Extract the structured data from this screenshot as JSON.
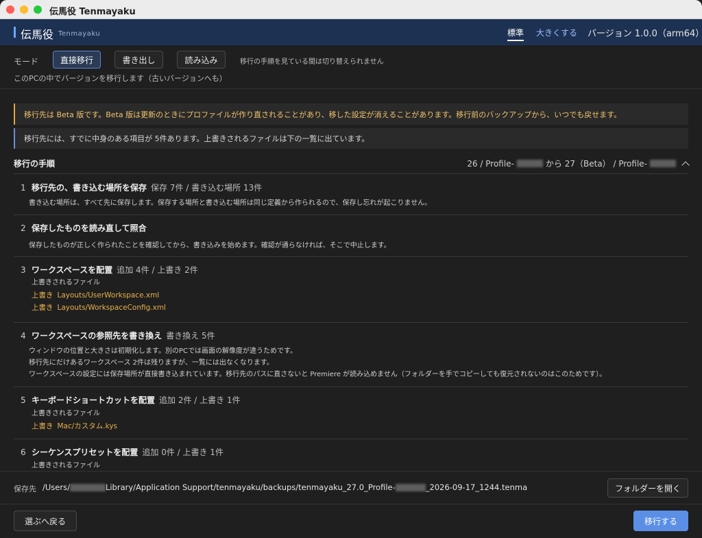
{
  "window": {
    "title": "伝馬役 Tenmayaku"
  },
  "header": {
    "brand": "伝馬役",
    "brand_sub": "Tenmayaku",
    "size_standard": "標準",
    "size_large": "大きくする",
    "version": "バージョン 1.0.0（arm64）"
  },
  "mode": {
    "label": "モード",
    "buttons": [
      "直接移行",
      "書き出し",
      "読み込み"
    ],
    "active": "直接移行",
    "note": "移行の手順を見ている間は切り替えられません",
    "description": "このPCの中でバージョンを移行します（古いバージョンへも）"
  },
  "alerts": {
    "warning": "移行先は Beta 版です。Beta 版は更新のときにプロファイルが作り直されることがあり、移した設定が消えることがあります。移行前のバックアップから、いつでも戻せます。",
    "info": "移行先には、すでに中身のある項目が 5件あります。上書きされるファイルは下の一覧に出ています。"
  },
  "steps_header": {
    "title": "移行の手順",
    "from_prefix": "26 / Profile-",
    "from_to": " から 27（Beta） / Profile-"
  },
  "steps": [
    {
      "num": "1",
      "name": "移行先の、書き込む場所を保存",
      "meta": "保存 7件 / 書き込む場所 13件",
      "desc": [
        "書き込む場所は、すべて先に保存します。保存する場所と書き込む場所は同じ定義から作られるので、保存し忘れが起こりません。"
      ]
    },
    {
      "num": "2",
      "name": "保存したものを読み直して照合",
      "meta": "",
      "desc": [
        "保存したものが正しく作られたことを確認してから、書き込みを始めます。確認が通らなければ、そこで中止します。"
      ]
    },
    {
      "num": "3",
      "name": "ワークスペースを配置",
      "meta": "追加 4件 / 上書き 2件",
      "files_header": "上書きされるファイル",
      "files": [
        {
          "tag": "上書き",
          "path": "Layouts/UserWorkspace.xml"
        },
        {
          "tag": "上書き",
          "path": "Layouts/WorkspaceConfig.xml"
        }
      ]
    },
    {
      "num": "4",
      "name": "ワークスペースの参照先を書き換え",
      "meta": "書き換え 5件",
      "desc": [
        "ウィンドウの位置と大きさは初期化します。別のPCでは画面の解像度が違うためです。",
        "移行先にだけあるワークスペース 2件は残りますが、一覧には出なくなります。",
        "ワークスペースの設定には保存場所が直接書き込まれています。移行先のパスに直さないと Premiere が読み込めません（フォルダーを手でコピーしても復元されないのはこのためです）。"
      ]
    },
    {
      "num": "5",
      "name": "キーボードショートカットを配置",
      "meta": "追加 2件 / 上書き 1件",
      "files_header": "上書きされるファイル",
      "files": [
        {
          "tag": "上書き",
          "path": "Mac/カスタム.kys"
        }
      ]
    },
    {
      "num": "6",
      "name": "シーケンスプリセットを配置",
      "meta": "追加 0件 / 上書き 1件",
      "files_header": "上書きされるファイル"
    }
  ],
  "footer": {
    "save_label": "保存先",
    "path_prefix": "/Users/",
    "path_middle": "Library/Application Support/tenmayaku/backups/tenmayaku_27.0_Profile-",
    "path_suffix": "_2026-09-17_1244.tenma",
    "open_folder": "フォルダーを開く",
    "back": "選ぶへ戻る",
    "migrate": "移行する"
  },
  "colors": {
    "header_bg": "#1d3152",
    "accent": "#5b8fe6",
    "warning": "#e2a53a",
    "file_overwrite": "#e8b04a"
  }
}
